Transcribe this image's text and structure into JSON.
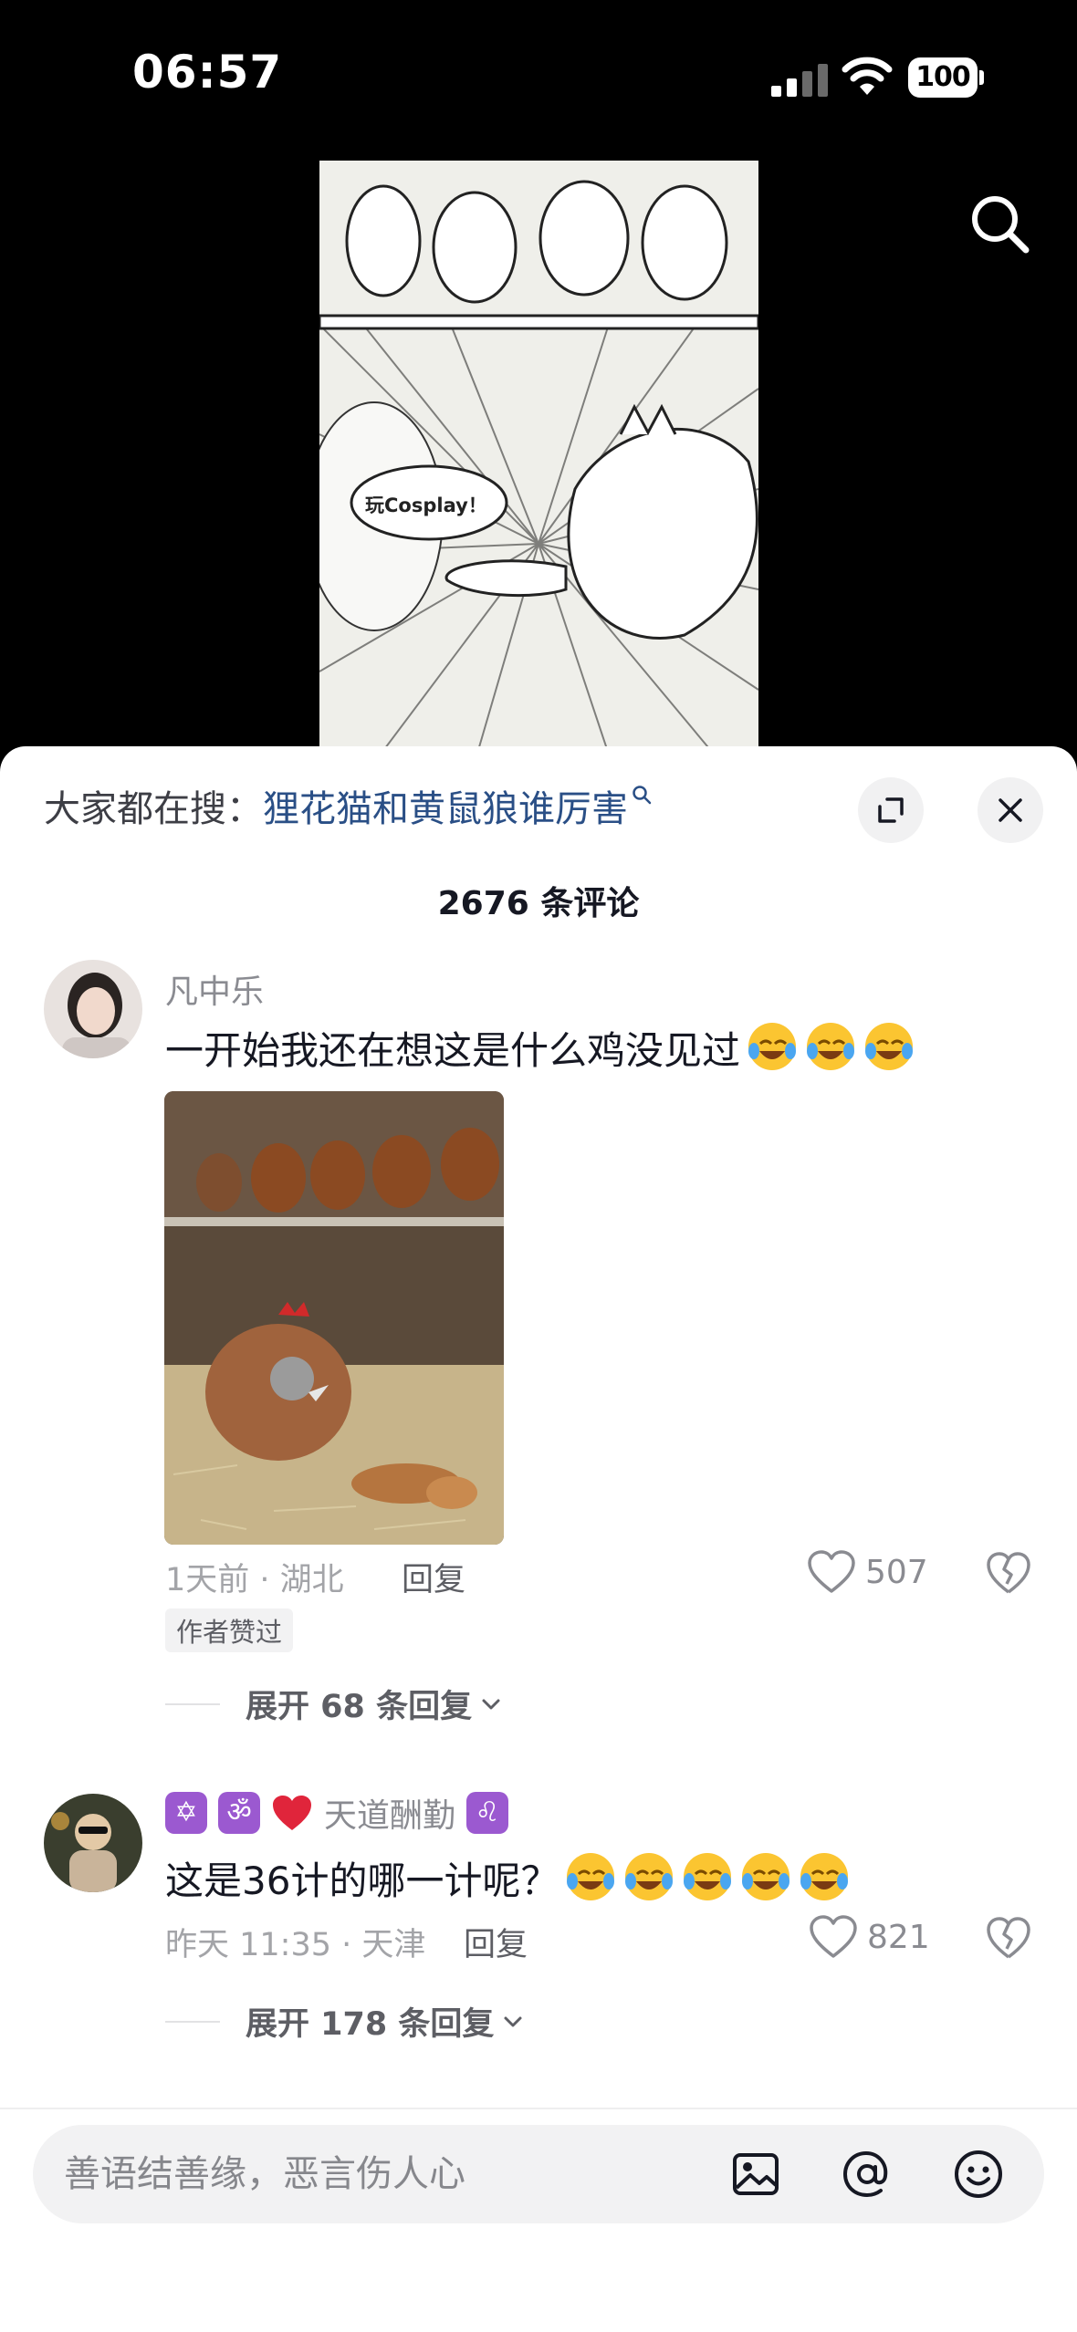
{
  "status_bar": {
    "time": "06:57",
    "battery": "100"
  },
  "hot_search": {
    "prefix": "大家都在搜：",
    "term": "狸花猫和黄鼠狼谁厉害"
  },
  "video": {
    "speech_bubble": "玩Cosplay！"
  },
  "comments_header": {
    "count_label": "2676 条评论"
  },
  "comments": [
    {
      "username": "凡中乐",
      "text": "一开始我还在想这是什么鸡没见过",
      "emoji": [
        "sob-laugh",
        "sob-laugh",
        "sob-laugh"
      ],
      "meta": "1天前 · 湖北",
      "reply_label": "回复",
      "likes": "507",
      "author_tag": "作者赞过",
      "expand_label": "展开 68 条回复"
    },
    {
      "username": "天道酬勤",
      "badges": [
        "✡",
        "ॐ"
      ],
      "text": "这是36计的哪一计呢？",
      "emoji": [
        "sob-laugh",
        "sob-laugh",
        "sob-laugh",
        "sob-laugh",
        "sob-laugh"
      ],
      "meta": "昨天 11:35 · 天津",
      "reply_label": "回复",
      "likes": "821",
      "expand_label": "展开 178 条回复"
    }
  ],
  "input_bar": {
    "placeholder": "善语结善缘，恶言伤人心"
  },
  "colors": {
    "hot_search_term": "#2a4f86",
    "badge": "#9b59d0",
    "sheet_bg": "#ffffff"
  }
}
